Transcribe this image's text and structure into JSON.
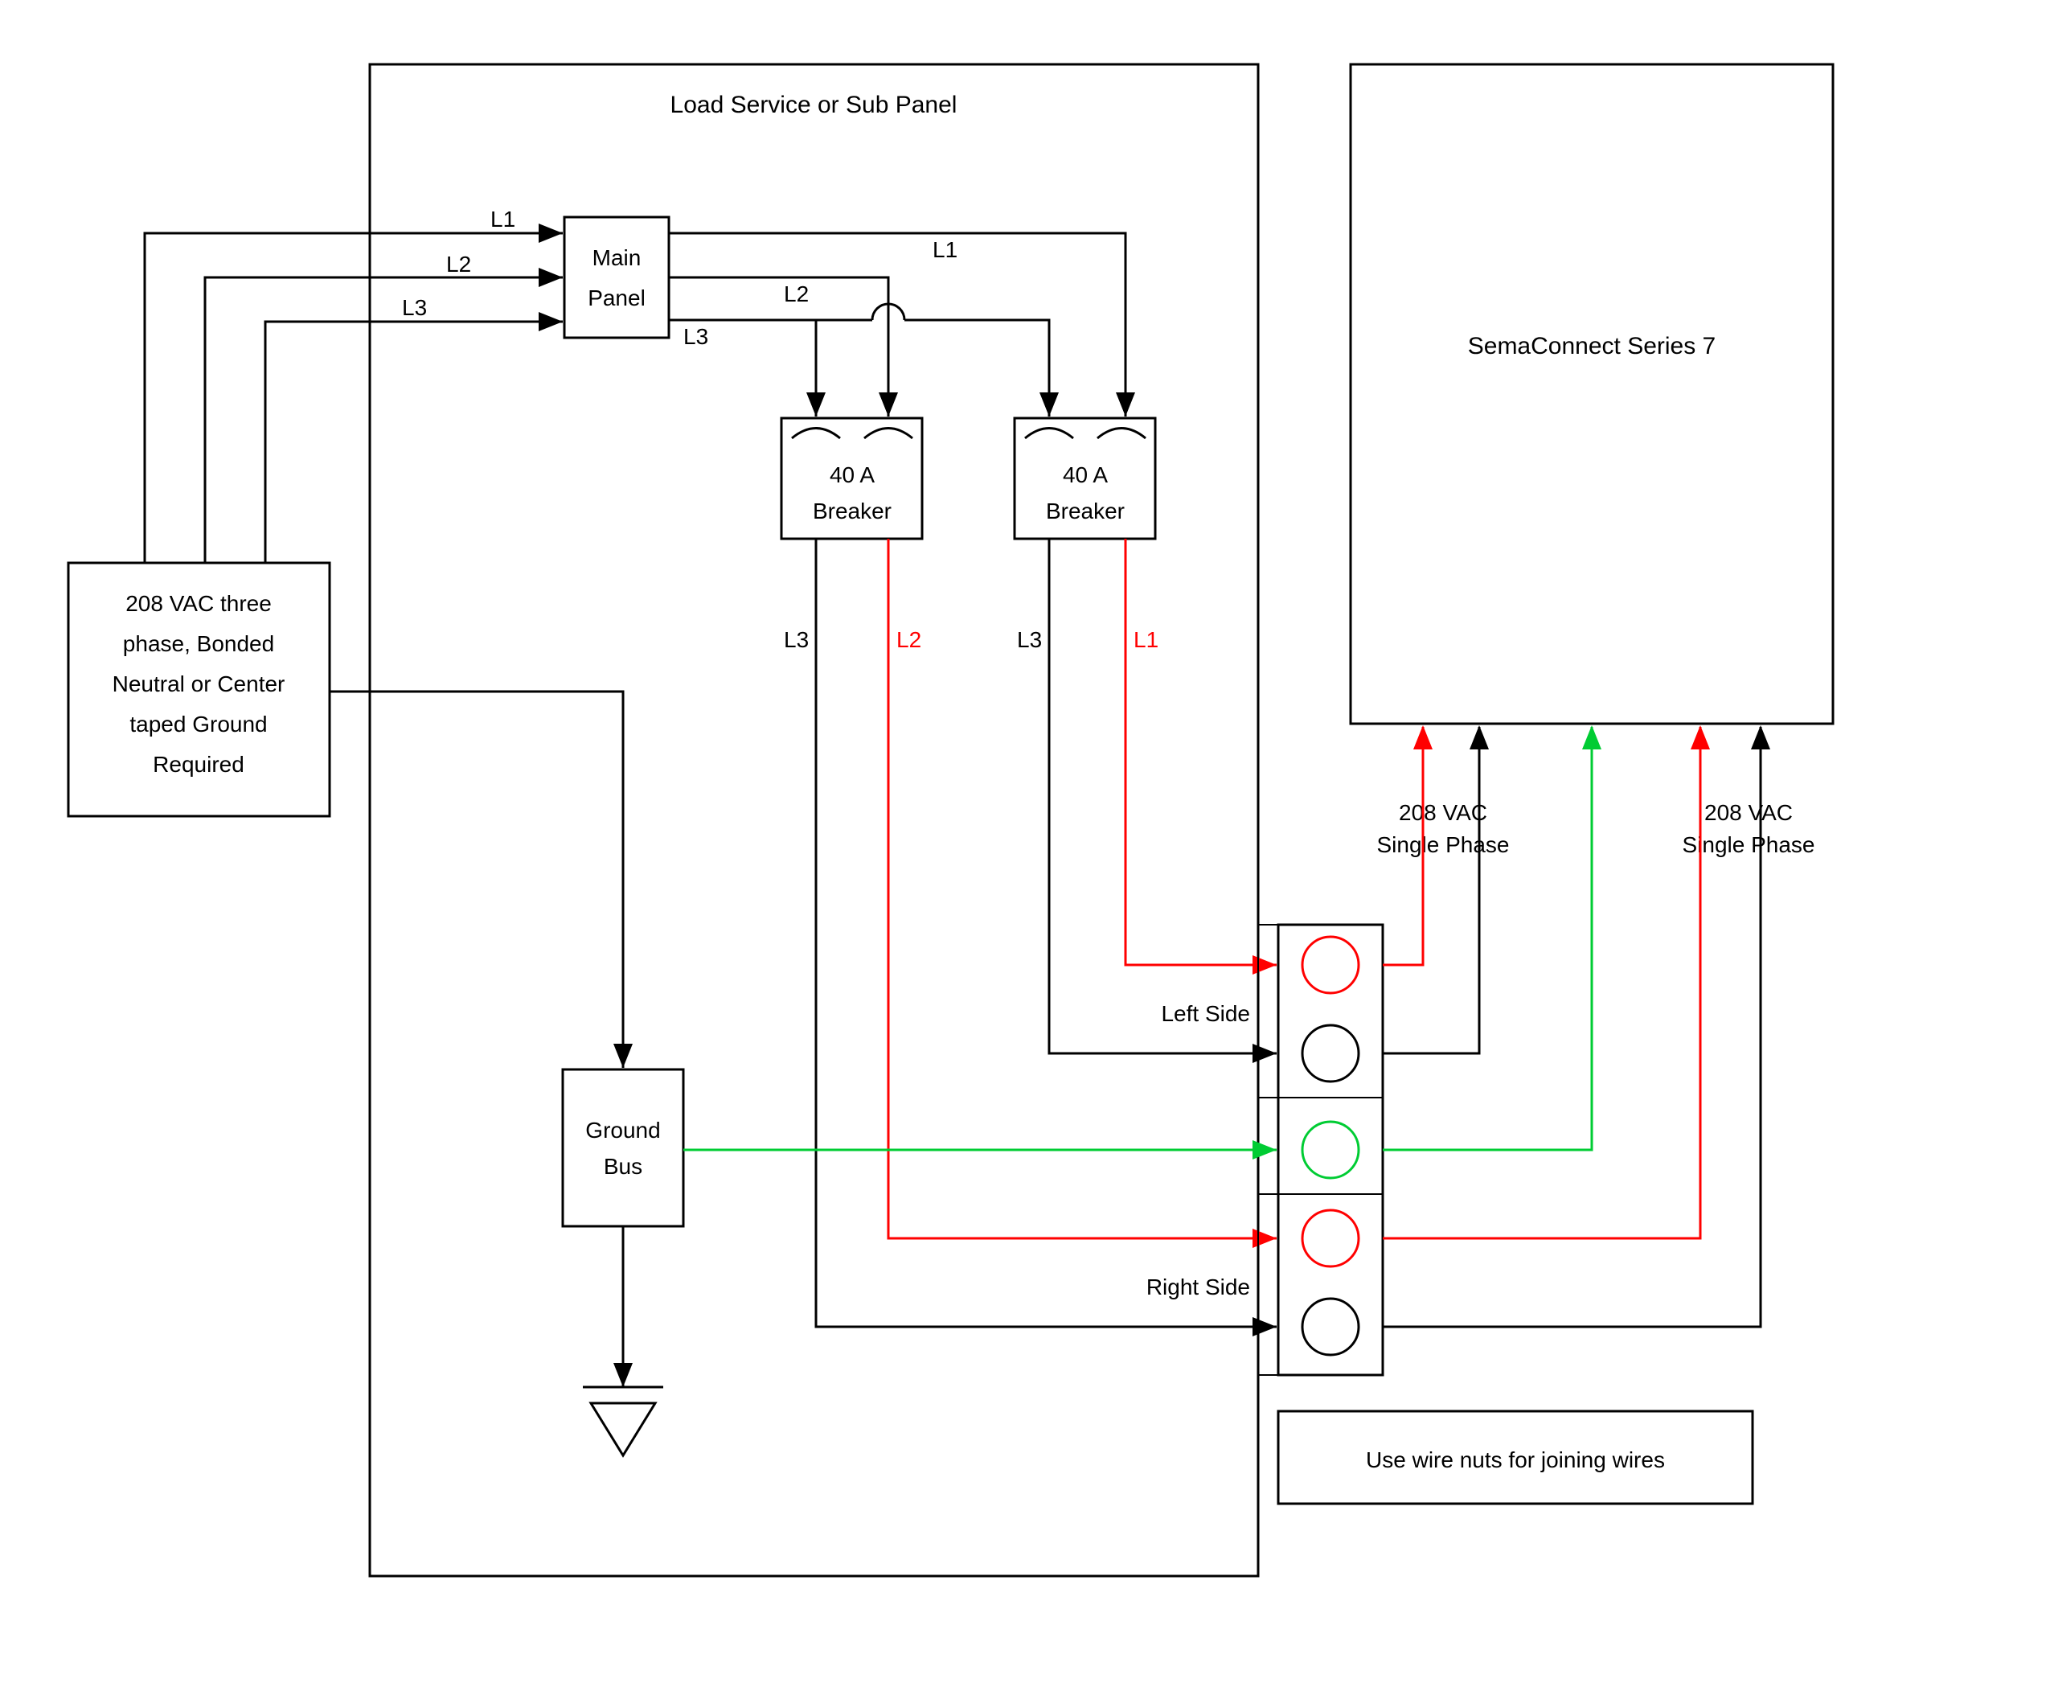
{
  "panel": {
    "title": "Load Service or Sub Panel"
  },
  "source": {
    "line1": "208 VAC three",
    "line2": "phase, Bonded",
    "line3": "Neutral or Center",
    "line4": "taped Ground",
    "line5": "Required"
  },
  "mainPanel": {
    "line1": "Main",
    "line2": "Panel"
  },
  "breakerA": {
    "line1": "40 A",
    "line2": "Breaker"
  },
  "breakerB": {
    "line1": "40 A",
    "line2": "Breaker"
  },
  "groundBus": {
    "line1": "Ground",
    "line2": "Bus"
  },
  "charger": {
    "title": "SemaConnect Series 7"
  },
  "labels": {
    "L1": "L1",
    "L2": "L2",
    "L3": "L3",
    "leftSide": "Left Side",
    "rightSide": "Right Side",
    "phase1": "208 VAC",
    "phase1b": "Single Phase",
    "phase2": "208 VAC",
    "phase2b": "Single Phase"
  },
  "note": "Use wire nuts for joining wires",
  "colors": {
    "black": "#000000",
    "red": "#ff0000",
    "green": "#00cc33"
  }
}
